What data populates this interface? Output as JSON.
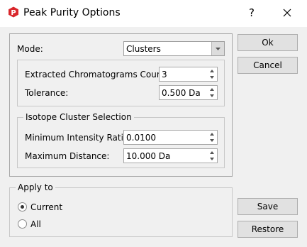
{
  "window": {
    "title": "Peak Purity Options",
    "help_label": "?",
    "app_icon": "app-logo-icon",
    "close_icon": "close-icon"
  },
  "mode": {
    "label": "Mode:",
    "selected": "Clusters"
  },
  "extracted": {
    "count_label": "Extracted Chromatograms Count:",
    "count_value": "3",
    "tolerance_label": "Tolerance:",
    "tolerance_value": "0.500 Da"
  },
  "isotope": {
    "legend": "Isotope Cluster Selection",
    "ratio_label": "Minimum Intensity Ratio:",
    "ratio_value": "0.0100",
    "distance_label": "Maximum Distance:",
    "distance_value": "10.000 Da"
  },
  "apply": {
    "legend": "Apply to",
    "options": [
      {
        "label": "Current",
        "checked": true
      },
      {
        "label": "All",
        "checked": false
      }
    ]
  },
  "buttons": {
    "ok": "Ok",
    "cancel": "Cancel",
    "save": "Save",
    "restore": "Restore"
  },
  "colors": {
    "icon_red": "#d9262b",
    "window_bg": "#f0f0f0",
    "titlebar_bg": "#ffffff"
  }
}
